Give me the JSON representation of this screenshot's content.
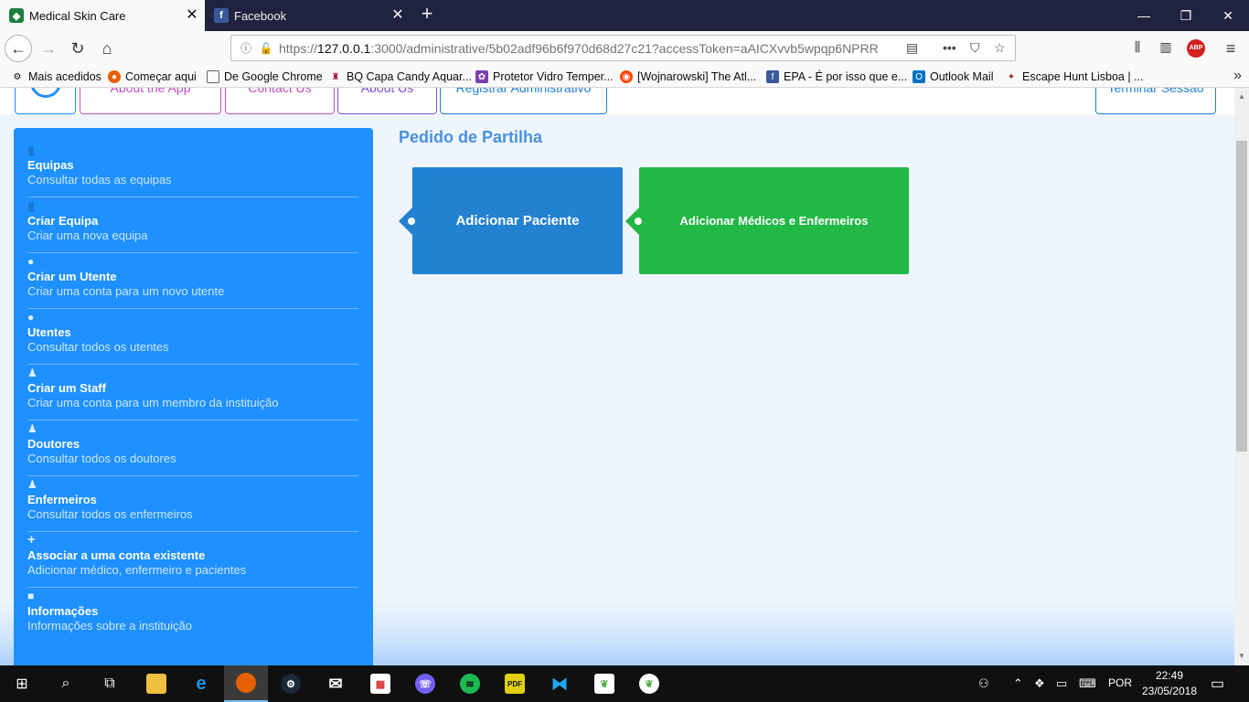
{
  "browser": {
    "tabs": [
      {
        "title": "Medical Skin Care",
        "active": true
      },
      {
        "title": "Facebook",
        "active": false
      }
    ],
    "url_prefix": "https://",
    "url_host": "127.0.0.1",
    "url_rest": ":3000/administrative/5b02adf96b6f970d68d27c21?accessToken=aAICXvvb5wpqp6NPRR",
    "bookmarks": [
      "Mais acedidos",
      "Começar aqui",
      "De Google Chrome",
      "BQ Capa Candy Aquar...",
      "Protetor Vidro Temper...",
      "[Wojnarowski] The Atl...",
      "EPA - É por isso que e...",
      "Outlook Mail",
      "Escape Hunt Lisboa | ..."
    ]
  },
  "page": {
    "top_nav": {
      "about_app": "About the App",
      "contact_us": "Contact Us",
      "about_us": "About Us",
      "registar_admin": "Registrar Administrativo",
      "terminar_sessao": "Terminar Sessão"
    },
    "sidebar": {
      "items": [
        {
          "icon": "group-icon",
          "title": "Equipas",
          "desc": "Consultar todas as equipas"
        },
        {
          "icon": "group-icon",
          "title": "Criar Equipa",
          "desc": "Criar uma nova equipa"
        },
        {
          "icon": "user-icon",
          "title": "Criar um Utente",
          "desc": "Criar uma conta para um novo utente"
        },
        {
          "icon": "user-icon",
          "title": "Utentes",
          "desc": "Consultar todos os utentes"
        },
        {
          "icon": "staff-icon",
          "title": "Criar um Staff",
          "desc": "Criar uma conta para um membro da instituição"
        },
        {
          "icon": "staff-icon",
          "title": "Doutores",
          "desc": "Consultar todos os doutores"
        },
        {
          "icon": "staff-icon",
          "title": "Enfermeiros",
          "desc": "Consultar todos os enfermeiros"
        },
        {
          "icon": "plus-icon",
          "title": "Associar a uma conta existente",
          "desc": "Adicionar médico, enfermeiro e pacientes"
        },
        {
          "icon": "lock-icon",
          "title": "Informações",
          "desc": "Informações sobre a instituição"
        }
      ]
    },
    "title": "Pedido de Partilha",
    "cards": {
      "patient": "Adicionar Paciente",
      "doctors": "Adicionar Médicos e Enfermeiros"
    },
    "colors": {
      "sidebar": "#1e90ff",
      "card_patient": "#2381d1",
      "card_doctors": "#22b845",
      "title": "#4a90e2"
    }
  },
  "taskbar": {
    "language": "POR",
    "time": "22:49",
    "date": "23/05/2018"
  }
}
